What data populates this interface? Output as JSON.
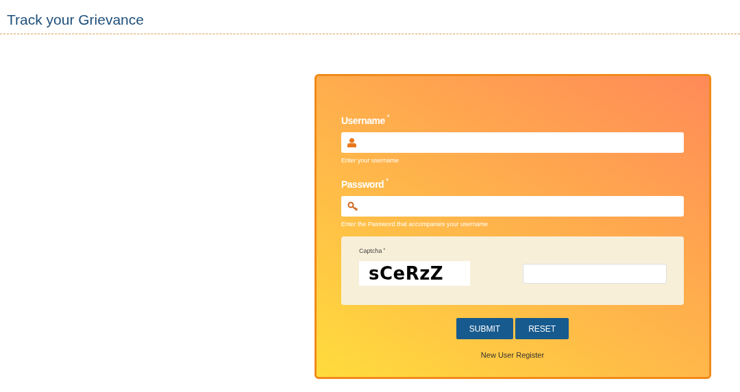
{
  "page_title": "Track your Grievance",
  "fields": [
    {
      "kind": "user",
      "label": "Username",
      "required_mark": "*",
      "hint": "Enter your username"
    },
    {
      "kind": "key",
      "label": "Password",
      "required_mark": "*",
      "hint": "Enter the Password that accompanies your username"
    }
  ],
  "captcha": {
    "label": "Captcha",
    "required_mark": "*",
    "code": "sCeRzZ"
  },
  "buttons": [
    "SUBMIT",
    "RESET"
  ],
  "register_link": "New User Register"
}
